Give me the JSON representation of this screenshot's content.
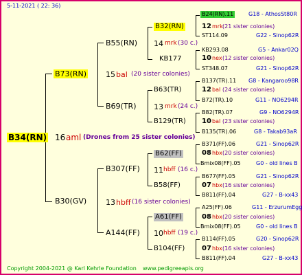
{
  "header": {
    "date": "5-11-2021 ( 22: 36)"
  },
  "footer": {
    "copyright": "Copyright 2004-2021 @ Karl Kehrle Foundation",
    "site": "www.pedigreeapis.org"
  },
  "root": {
    "id": "B34(RN)",
    "gen": "16",
    "code": "aml",
    "note": "(Drones from 25 sister colonies)"
  },
  "gen1": [
    {
      "id": "B73(RN)",
      "gen": "15",
      "code": "bal",
      "note": "(20 sister colonies)"
    },
    {
      "id": "B30(GV)",
      "gen": "13",
      "code": "hbff",
      "note": "(16 sister colonies)"
    }
  ],
  "gen2": [
    {
      "id": "B55(RN)",
      "gen": "14",
      "code": "mrk",
      "note": "(30 c.)"
    },
    {
      "id": "B69(TR)",
      "gen": "13",
      "code": "mrk",
      "note": "(24 c.)"
    },
    {
      "id": "B307(FF)",
      "gen": "11",
      "code": "hbff",
      "note": "(16 c.)"
    },
    {
      "id": "A144(FF)",
      "gen": "10",
      "code": "hbff",
      "note": "(19 c.)"
    }
  ],
  "gen3": [
    {
      "id": "B32(RN)",
      "gen": "12",
      "code": "mrk",
      "note": "(21 sister colonies)"
    },
    {
      "id": "KB177",
      "gen": "10",
      "code": "nex",
      "note": "(12 sister colonies)"
    },
    {
      "id": "B63(TR)",
      "gen": "12",
      "code": "bal",
      "note": "(24 sister colonies)"
    },
    {
      "id": "B129(TR)",
      "gen": "10",
      "code": "bal",
      "note": "(23 sister colonies)"
    },
    {
      "id": "B62(FF)",
      "gen": "08",
      "code": "hbx",
      "note": "(20 sister colonies)"
    },
    {
      "id": "B58(FF)",
      "gen": "07",
      "code": "hbx",
      "note": "(16 sister colonies)"
    },
    {
      "id": "A61(FF)",
      "gen": "08",
      "code": "hbx",
      "note": "(20 sister colonies)"
    },
    {
      "id": "B104(FF)",
      "gen": "07",
      "code": "hbx",
      "note": "(16 sister colonies)"
    }
  ],
  "gen4": [
    {
      "id": "B24(RN).11",
      "info": "G18 - AthosSt80R"
    },
    {
      "id": "ST114.09",
      "info": "G22 - Sinop62R"
    },
    {
      "id": "KB293.08",
      "info": "G5 - Ankar02Q"
    },
    {
      "id": "ST348.07",
      "info": "G21 - Sinop62R"
    },
    {
      "id": "B137(TR).11",
      "info": "G8 - Kangaroo98R"
    },
    {
      "id": "B72(TR).10",
      "info": "G11 - NO6294R"
    },
    {
      "id": "B82(TR).07",
      "info": "G9 - NO6294R"
    },
    {
      "id": "B135(TR).06",
      "info": "G8 - Takab93aR"
    },
    {
      "id": "B371(FF).06",
      "info": "G21 - Sinop62R"
    },
    {
      "id": "Bmix08(FF).05",
      "info": "G0 - old lines B"
    },
    {
      "id": "B677(FF).05",
      "info": "G21 - Sinop62R"
    },
    {
      "id": "B811(FF).04",
      "info": "G27 - B-xx43"
    },
    {
      "id": "A25(FF).06",
      "info": "G11 - ErzurumEgg8"
    },
    {
      "id": "Bmix08(FF).05",
      "info": "G0 - old lines B"
    },
    {
      "id": "B114(FF).05",
      "info": "G20 - Sinop62R"
    },
    {
      "id": "B811(FF).04",
      "info": "G27 - B-xx43"
    }
  ],
  "colors": {
    "frame": "#D6006B",
    "background": "#FFFFDD",
    "root_hl": "#FFFF00",
    "b73_hl": "#FFFF00",
    "b32_hl": "#FFFF00",
    "b24_hl": "#33CC33",
    "gray_hl": "#C0C0C0"
  }
}
